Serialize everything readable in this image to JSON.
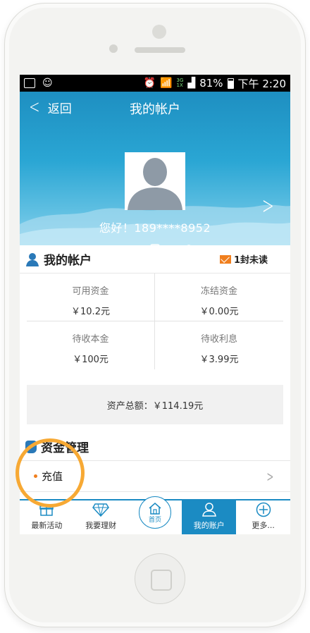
{
  "status_bar": {
    "net_top": "3G",
    "net_bottom": "1X",
    "battery": "81%",
    "time": "下午 2:20"
  },
  "header": {
    "back_label": "返回",
    "title": "我的帐户",
    "greeting": "您好！189****8952"
  },
  "account": {
    "title": "我的帐户",
    "unread": "1封未读",
    "cells": [
      {
        "label": "可用资金",
        "value": "￥10.2元"
      },
      {
        "label": "冻结资金",
        "value": "￥0.00元"
      },
      {
        "label": "待收本金",
        "value": "￥100元"
      },
      {
        "label": "待收利息",
        "value": "￥3.99元"
      }
    ],
    "total": "资产总额：￥114.19元"
  },
  "fund": {
    "title": "资金管理",
    "items": [
      {
        "label": "充值"
      }
    ]
  },
  "tabbar": {
    "items": [
      {
        "label": "最新活动"
      },
      {
        "label": "我要理财"
      },
      {
        "label": "首页"
      },
      {
        "label": "我的账户"
      },
      {
        "label": "更多..."
      }
    ]
  },
  "colors": {
    "accent": "#1b8bc3",
    "orange": "#f07f1e",
    "highlight": "#f7a934"
  }
}
